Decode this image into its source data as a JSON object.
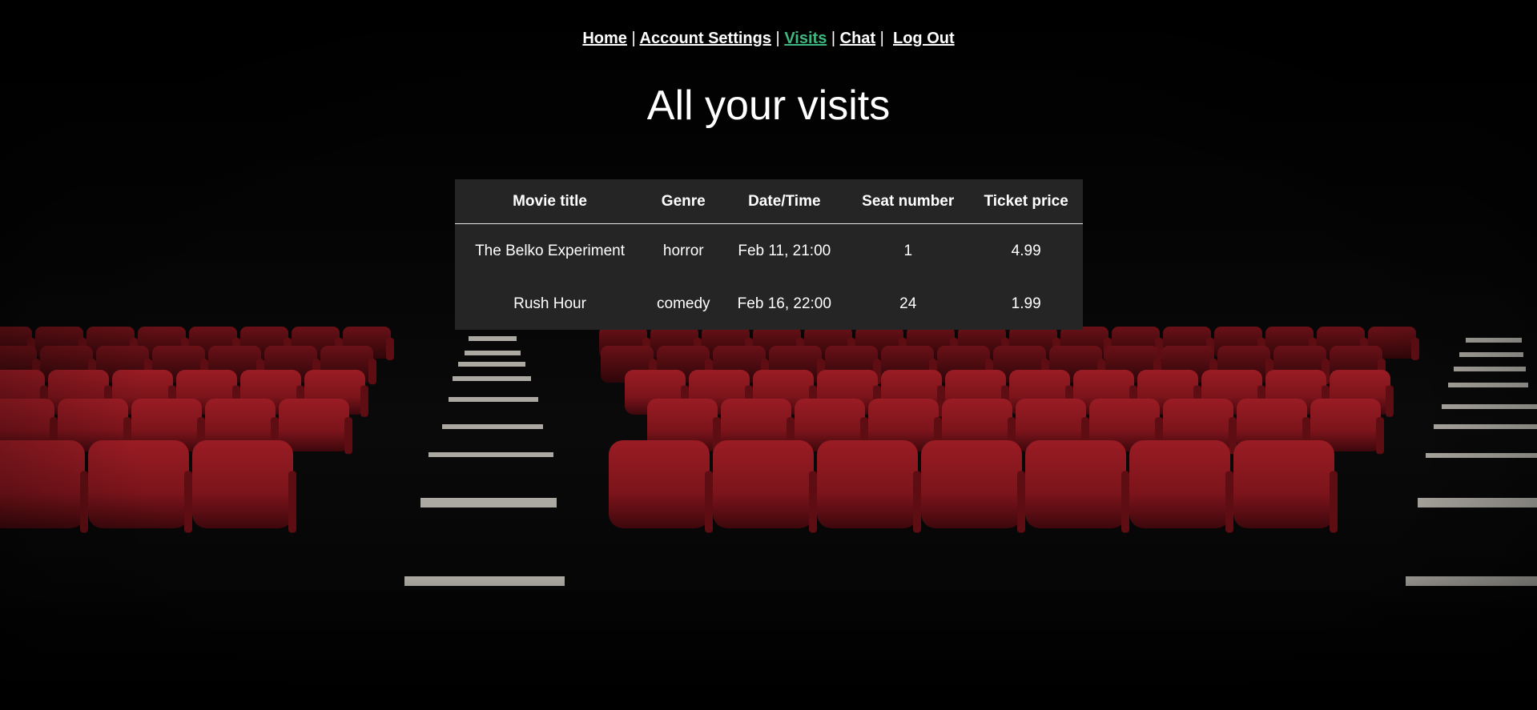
{
  "nav": {
    "home": "Home",
    "account_settings": "Account Settings",
    "visits": "Visits",
    "chat": "Chat",
    "log_out": "Log Out",
    "separator": "|",
    "active_color": "#3fb87f"
  },
  "page": {
    "title": "All your visits"
  },
  "visits_table": {
    "headers": [
      "Movie title",
      "Genre",
      "Date/Time",
      "Seat number",
      "Ticket price"
    ],
    "rows": [
      [
        "The Belko Experiment",
        "horror",
        "Feb 11, 21:00",
        "1",
        "4.99"
      ],
      [
        "Rush Hour",
        "comedy",
        "Feb 16, 22:00",
        "24",
        "1.99"
      ]
    ]
  },
  "background": {
    "description_icon": "theater-seats-image",
    "seat_color": "#8e1820"
  }
}
